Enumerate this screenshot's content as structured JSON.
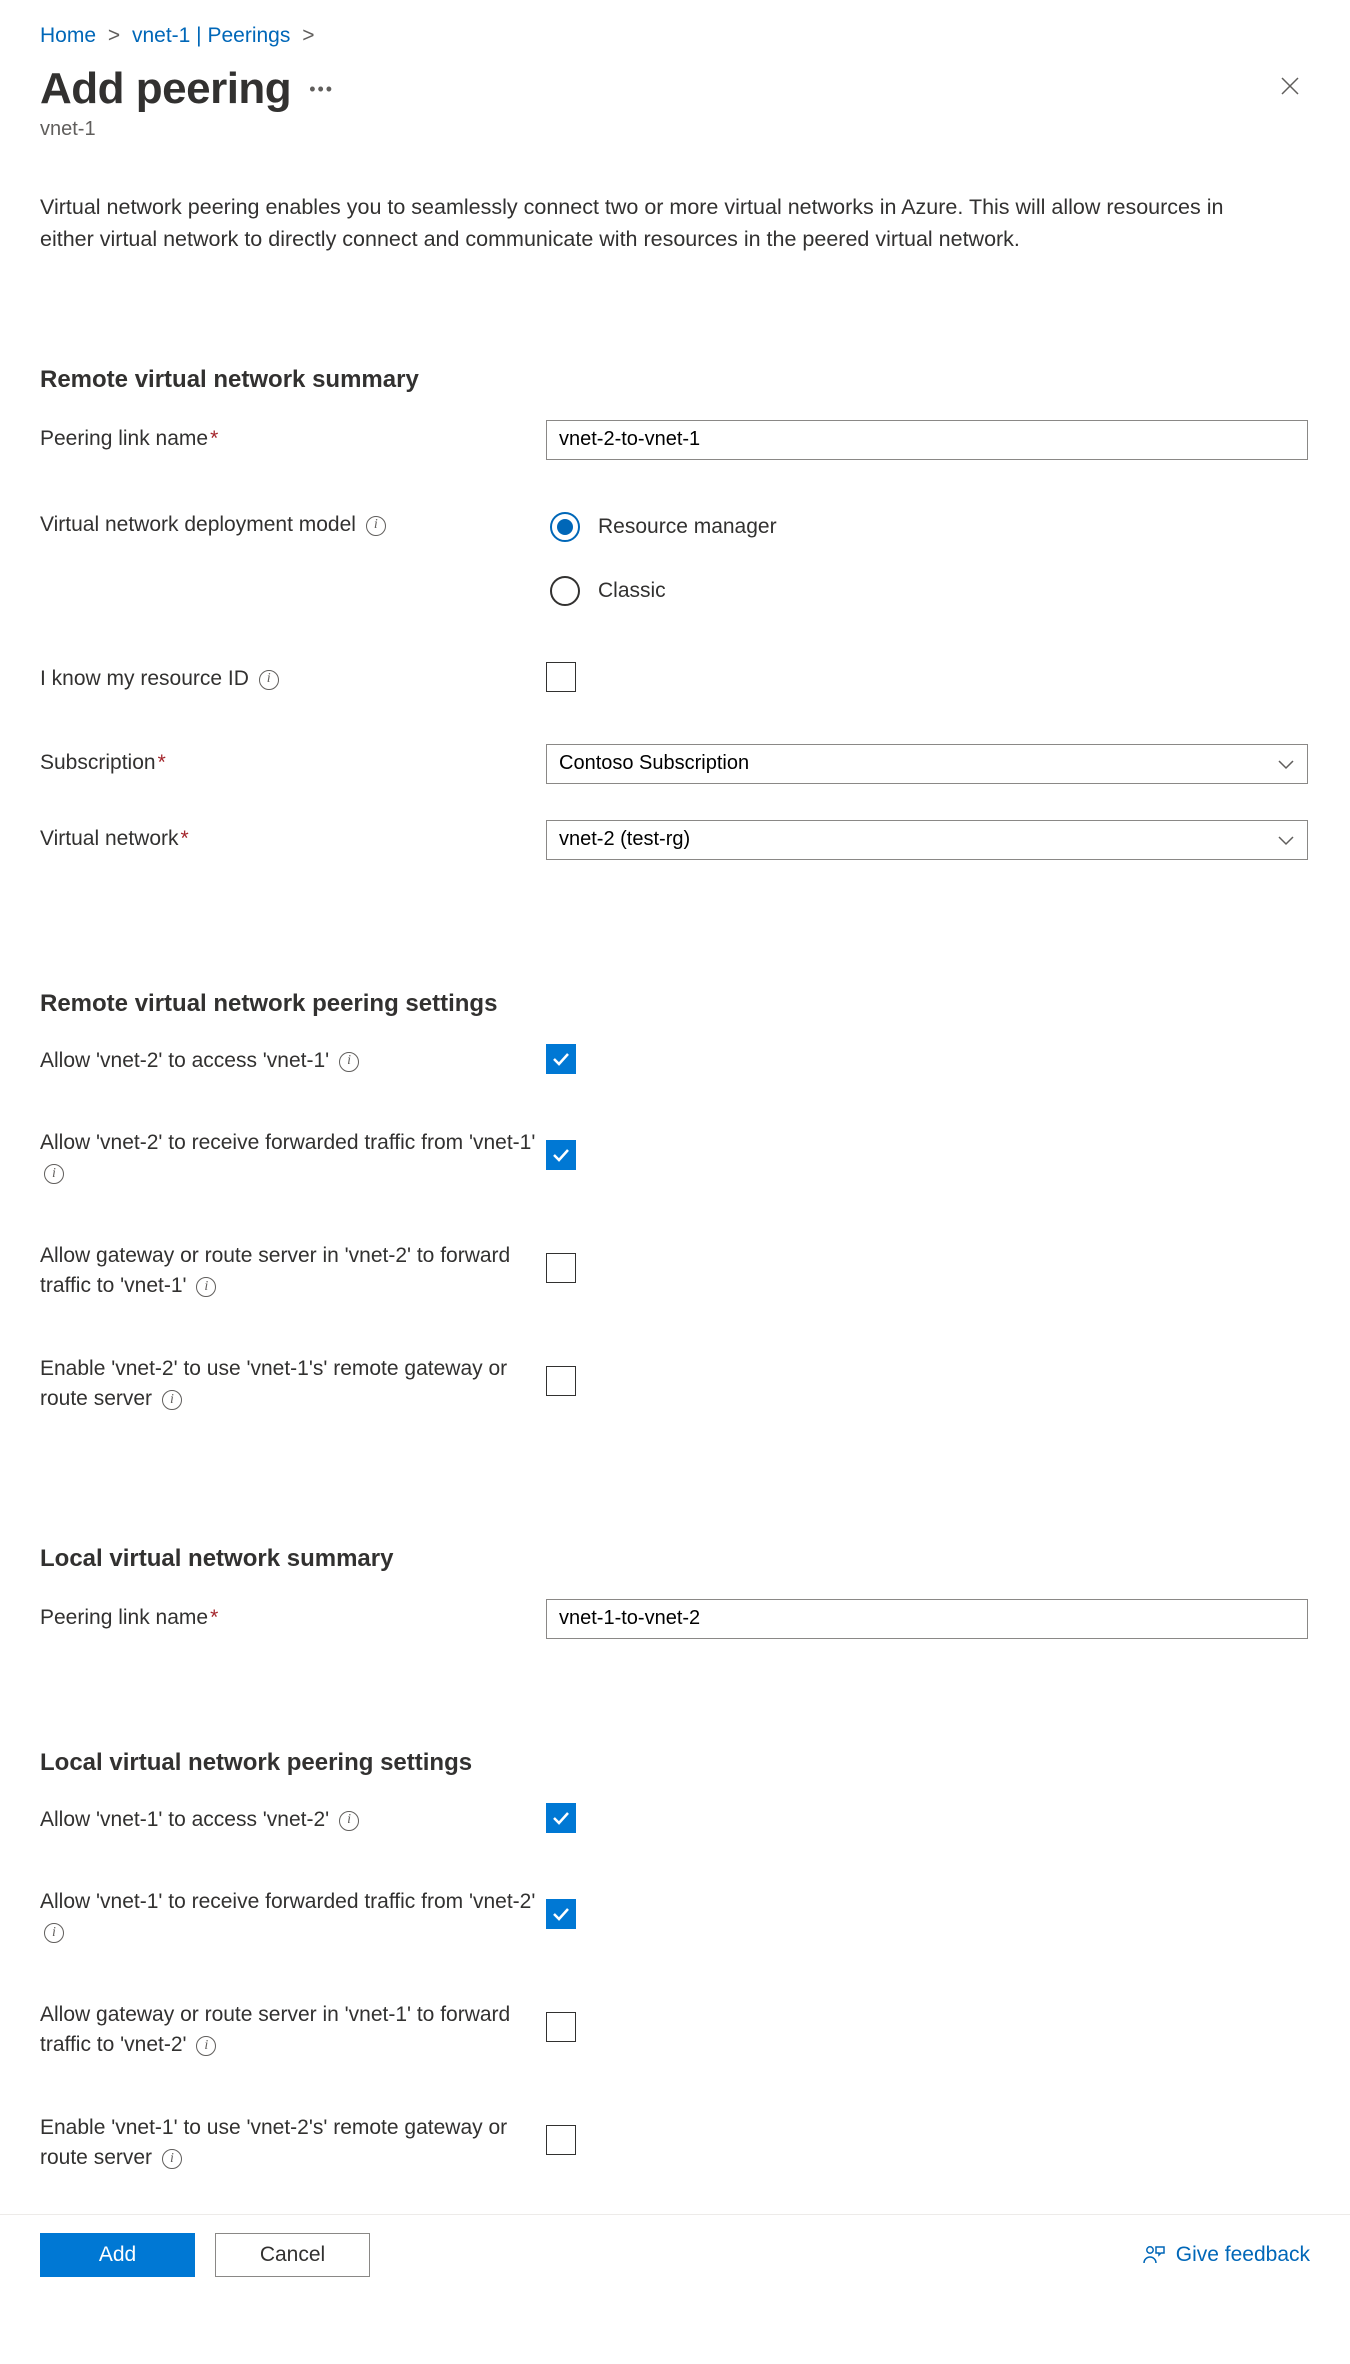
{
  "breadcrumb": {
    "home": "Home",
    "vnet": "vnet-1 | Peerings"
  },
  "header": {
    "title": "Add peering",
    "subtitle": "vnet-1"
  },
  "intro": "Virtual network peering enables you to seamlessly connect two or more virtual networks in Azure. This will allow resources in either virtual network to directly connect and communicate with resources in the peered virtual network.",
  "sections": {
    "remoteSummary": {
      "title": "Remote virtual network summary",
      "peeringLinkLabel": "Peering link name",
      "peeringLinkValue": "vnet-2-to-vnet-1",
      "deployModelLabel": "Virtual network deployment model",
      "deployOptions": {
        "rm": "Resource manager",
        "classic": "Classic"
      },
      "resourceIdLabel": "I know my resource ID",
      "subscriptionLabel": "Subscription",
      "subscriptionValue": "Contoso Subscription",
      "vnetLabel": "Virtual network",
      "vnetValue": "vnet-2 (test-rg)"
    },
    "remoteSettings": {
      "title": "Remote virtual network peering settings",
      "allowAccess": "Allow 'vnet-2' to access 'vnet-1'",
      "allowForwarded": "Allow 'vnet-2' to receive forwarded traffic from 'vnet-1'",
      "allowGateway": "Allow gateway or route server in 'vnet-2' to forward traffic to 'vnet-1'",
      "useRemoteGateway": "Enable 'vnet-2' to use 'vnet-1's' remote gateway or route server"
    },
    "localSummary": {
      "title": "Local virtual network summary",
      "peeringLinkLabel": "Peering link name",
      "peeringLinkValue": "vnet-1-to-vnet-2"
    },
    "localSettings": {
      "title": "Local virtual network peering settings",
      "allowAccess": "Allow 'vnet-1' to access 'vnet-2'",
      "allowForwarded": "Allow 'vnet-1' to receive forwarded traffic from 'vnet-2'",
      "allowGateway": "Allow gateway or route server in 'vnet-1' to forward traffic to 'vnet-2'",
      "useRemoteGateway": "Enable 'vnet-1' to use 'vnet-2's' remote gateway or route server"
    }
  },
  "footer": {
    "add": "Add",
    "cancel": "Cancel",
    "feedback": "Give feedback"
  }
}
